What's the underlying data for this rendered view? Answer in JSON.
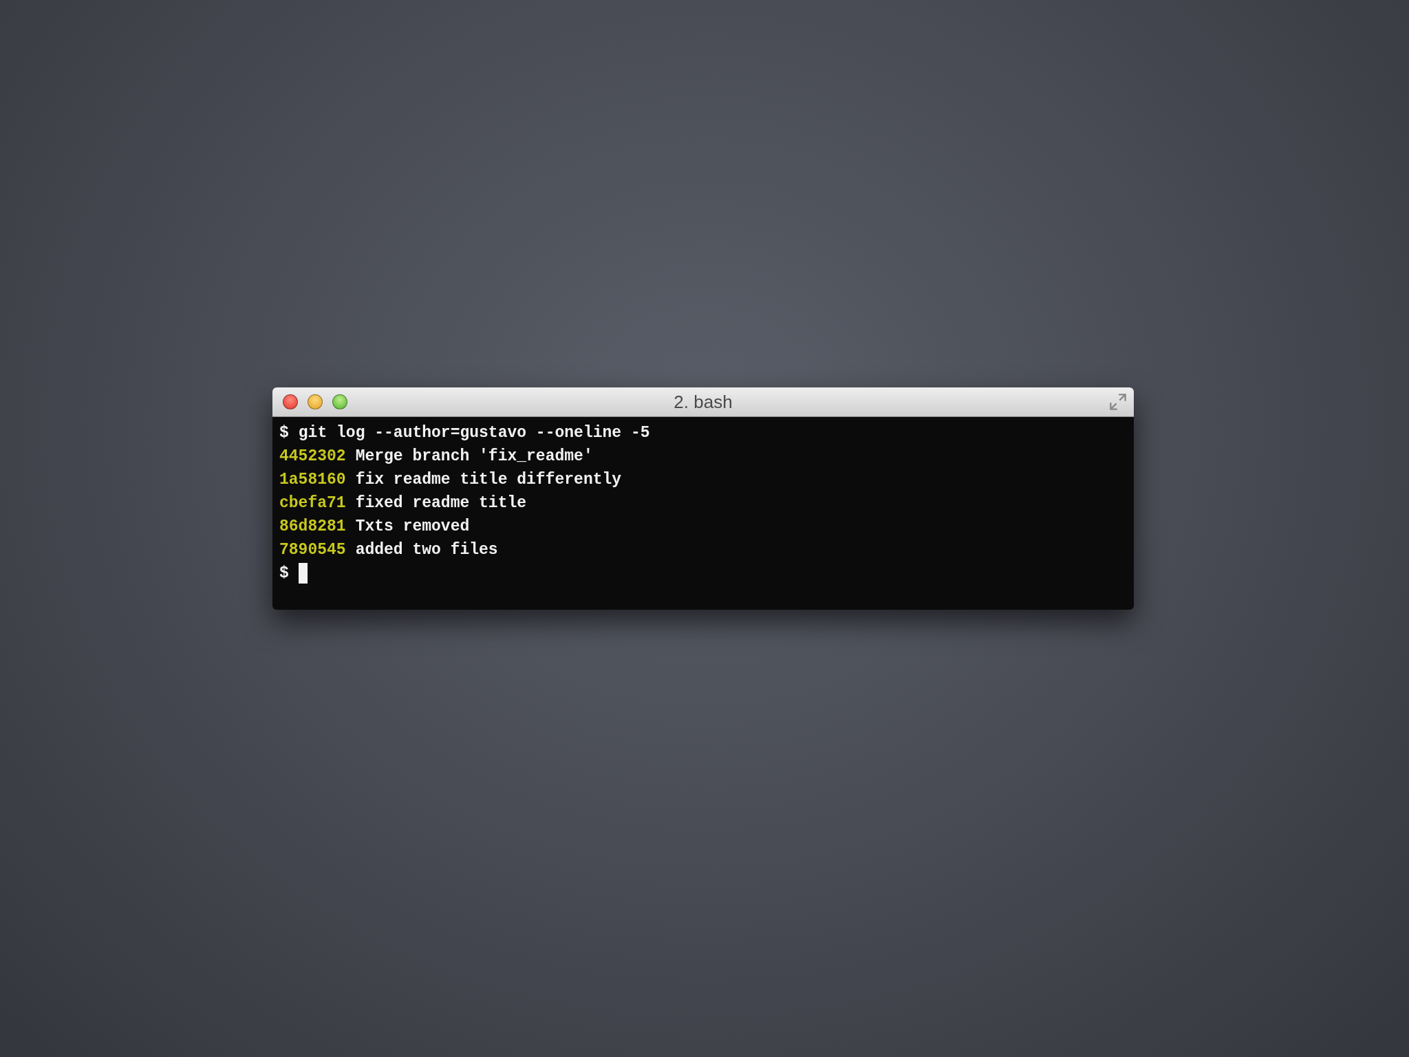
{
  "window": {
    "title": "2. bash"
  },
  "lines": [
    {
      "kind": "command",
      "prompt": "$",
      "text": "git log --author=gustavo --oneline -5"
    },
    {
      "kind": "commit",
      "hash": "4452302",
      "message": "Merge branch 'fix_readme'"
    },
    {
      "kind": "commit",
      "hash": "1a58160",
      "message": "fix readme title differently"
    },
    {
      "kind": "commit",
      "hash": "cbefa71",
      "message": "fixed readme title"
    },
    {
      "kind": "commit",
      "hash": "86d8281",
      "message": "Txts removed"
    },
    {
      "kind": "commit",
      "hash": "7890545",
      "message": "added two files"
    },
    {
      "kind": "input",
      "prompt": "$"
    }
  ]
}
